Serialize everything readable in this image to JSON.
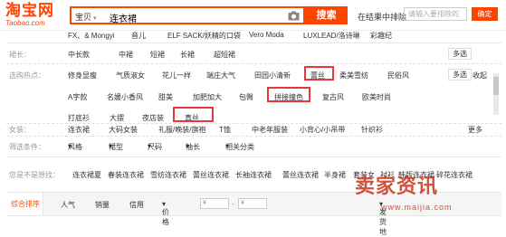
{
  "logo": {
    "cn": "淘宝网",
    "en": "Taobao.com"
  },
  "search": {
    "scope": "宝贝",
    "query": "连衣裙",
    "button": "搜索"
  },
  "within": {
    "label": "在结果中排除",
    "placeholder": "请输入要排除的",
    "confirm": "确定"
  },
  "brand_row_top": [
    "FX、& Mongyi",
    "音儿",
    "ELF SACK/妖精的口袋",
    "Vero Moda",
    "LUXLEAD/洛诗琳",
    "彩趣纪"
  ],
  "length": {
    "label": "裙长：",
    "items": [
      "中长款",
      "中裙",
      "短裙",
      "长裙",
      "超短裙"
    ],
    "multi": "多选"
  },
  "popular": {
    "label": "选购热点：",
    "row1": [
      "修身显瘦",
      "气质淑女",
      "花儿一样",
      "端庄大气",
      "田园小清新",
      "蕾丝",
      "柔美雪纺",
      "民俗风"
    ],
    "row2": [
      "A字款",
      "名媛小香风",
      "甜美",
      "加肥加大",
      "包臀",
      "拼接撞色",
      "复古风",
      "欧美时尚"
    ],
    "row3": [
      "打底衫",
      "大摆",
      "夜店装",
      "真丝"
    ],
    "multi": "多选",
    "collapse": "收起"
  },
  "women": {
    "label": "女装：",
    "items": [
      "连衣裙",
      "大码女装",
      "礼服/晚装/旗袍",
      "T恤",
      "中老年服装",
      "小背心/小吊带",
      "针织衫"
    ],
    "more": "更多"
  },
  "filter": {
    "label": "筛选条件：",
    "items": [
      "风格",
      "裙型",
      "尺码",
      "袖长",
      "相关分类"
    ]
  },
  "suggest": {
    "label": "您是不是想找：",
    "items": [
      "连衣裙夏",
      "春装连衣裙",
      "雪纺连衣裙",
      "蕾丝连衣裙",
      "长袖连衣裙",
      "蕾丝连衣裙",
      "半身裙",
      "套装女",
      "衬衫",
      "韩版连衣裙",
      "碎花连衣裙"
    ]
  },
  "sort": {
    "tabs": [
      "综合排序",
      "人气",
      "销量",
      "信用",
      "价格"
    ],
    "price_from": "¥",
    "price_to": "¥",
    "shipping": "发货地"
  },
  "watermark": {
    "main": "卖家资讯",
    "sub": "www.maijia.com"
  }
}
